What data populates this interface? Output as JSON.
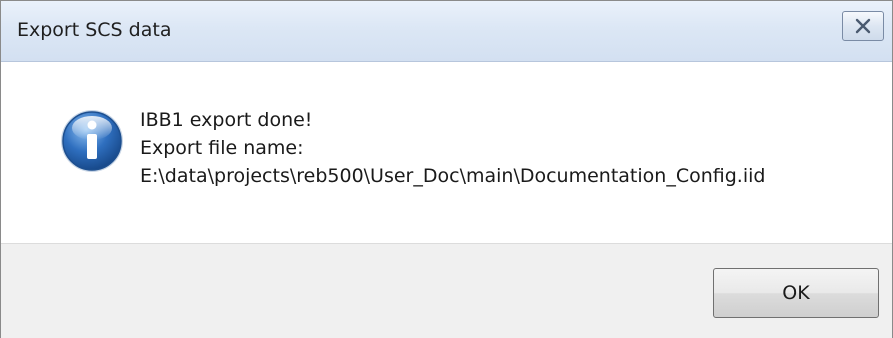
{
  "window": {
    "title": "Export SCS data",
    "close_icon": "close-icon"
  },
  "message": {
    "icon": "info-icon",
    "line1": "IBB1 export done!",
    "line2": "Export file name:",
    "line3": "E:\\data\\projects\\reb500\\User_Doc\\main\\Documentation_Config.iid"
  },
  "buttons": {
    "ok_label": "OK"
  },
  "colors": {
    "titlebar": "#dce7f5",
    "info_icon": "#2f6fbf",
    "footer": "#f0f0f0"
  }
}
